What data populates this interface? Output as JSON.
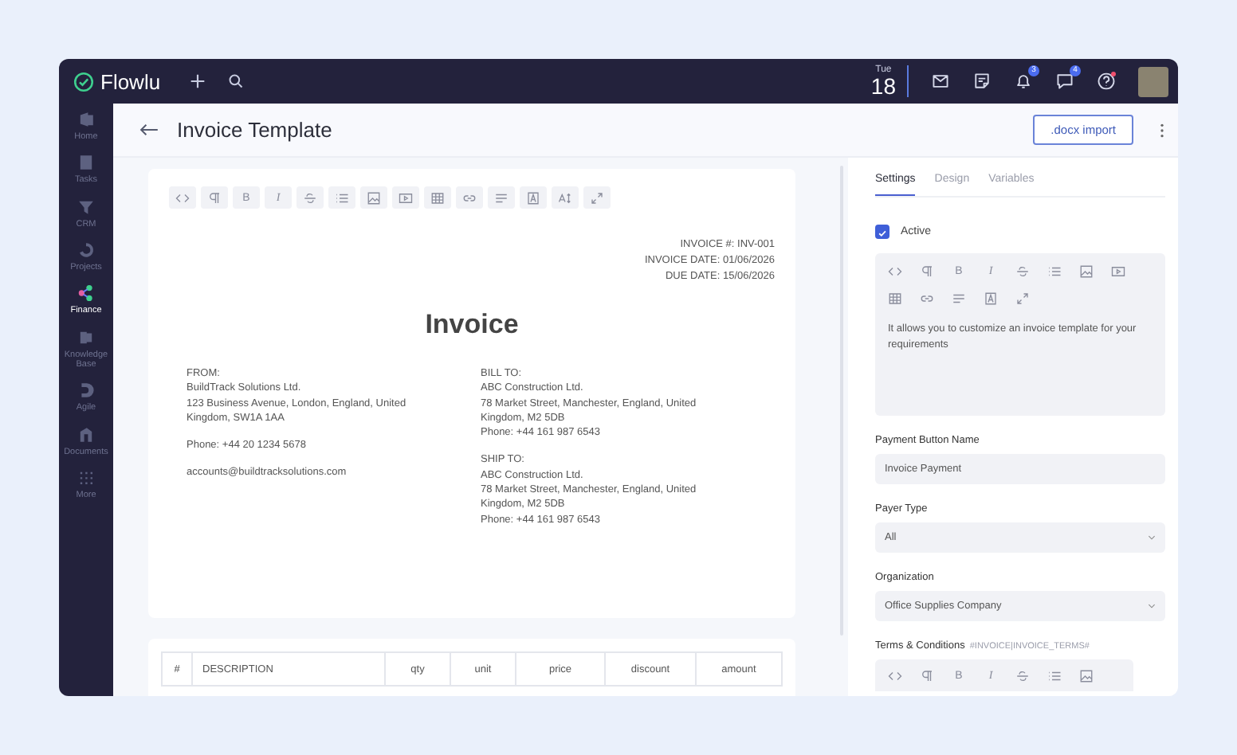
{
  "topbar": {
    "brand": "Flowlu",
    "date": {
      "weekday": "Tue",
      "day": "18"
    },
    "notifications": [
      {
        "kind": "mail"
      },
      {
        "kind": "notes"
      },
      {
        "kind": "bell",
        "count": "3"
      },
      {
        "kind": "chat",
        "count": "4"
      },
      {
        "kind": "help",
        "alert": true
      }
    ]
  },
  "sidebar": {
    "items": [
      {
        "label": "Home",
        "selected": false
      },
      {
        "label": "Tasks",
        "selected": false
      },
      {
        "label": "CRM",
        "selected": false
      },
      {
        "label": "Projects",
        "selected": false
      },
      {
        "label": "Finance",
        "selected": true
      },
      {
        "label": "Knowledge Base",
        "selected": false
      },
      {
        "label": "Agile",
        "selected": false
      },
      {
        "label": "Documents",
        "selected": false
      },
      {
        "label": "More",
        "selected": false
      }
    ]
  },
  "header": {
    "title": "Invoice Template",
    "import_button": ".docx import"
  },
  "editor_toolbar": [
    {
      "kind": "code"
    },
    {
      "kind": "paragraph"
    },
    {
      "kind": "glyph",
      "label": "B"
    },
    {
      "kind": "glyph",
      "label": "I"
    },
    {
      "kind": "strike"
    },
    {
      "kind": "list"
    },
    {
      "kind": "image"
    },
    {
      "kind": "video"
    },
    {
      "kind": "table"
    },
    {
      "kind": "link"
    },
    {
      "kind": "align"
    },
    {
      "kind": "color"
    },
    {
      "kind": "fontsize"
    },
    {
      "kind": "fullscreen"
    }
  ],
  "document": {
    "meta": [
      "INVOICE #: INV-001",
      "INVOICE DATE: 01/06/2026",
      "DUE DATE: 15/06/2026"
    ],
    "title": "Invoice",
    "from": {
      "lines": [
        "FROM:",
        "BuildTrack Solutions Ltd.",
        "123 Business Avenue, London, England, United Kingdom, SW1A 1AA"
      ],
      "phone": "Phone: +44 20 1234 5678",
      "email": "accounts@buildtracksolutions.com"
    },
    "bill_to": [
      "BILL TO:",
      "ABC Construction Ltd.",
      "78 Market Street, Manchester, England, United Kingdom, M2 5DB",
      "Phone: +44 161 987 6543"
    ],
    "ship_to": [
      "SHIP TO:",
      "ABC Construction Ltd.",
      "78 Market Street, Manchester, England, United Kingdom, M2 5DB",
      "Phone: +44 161 987 6543"
    ]
  },
  "table": {
    "columns": [
      "#",
      "DESCRIPTION",
      "qty",
      "unit",
      "price",
      "discount",
      "amount"
    ]
  },
  "settings": {
    "tabs": [
      {
        "label": "Settings",
        "selected": true
      },
      {
        "label": "Design",
        "selected": false
      },
      {
        "label": "Variables",
        "selected": false
      }
    ],
    "active": {
      "label": "Active",
      "checked": true
    },
    "description_toolbar": [
      {
        "kind": "code"
      },
      {
        "kind": "paragraph"
      },
      {
        "kind": "glyph",
        "label": "B"
      },
      {
        "kind": "glyph",
        "label": "I"
      },
      {
        "kind": "strike"
      },
      {
        "kind": "list"
      },
      {
        "kind": "image"
      },
      {
        "kind": "video"
      },
      {
        "kind": "table"
      },
      {
        "kind": "link"
      },
      {
        "kind": "align"
      },
      {
        "kind": "color"
      },
      {
        "kind": "fullscreen"
      }
    ],
    "description": "It allows you to customize an invoice template for your requirements",
    "fields": [
      {
        "kind": "input",
        "label": "Payment Button Name",
        "value": "Invoice Payment"
      },
      {
        "kind": "select",
        "label": "Payer Type",
        "value": "All"
      },
      {
        "kind": "select",
        "label": "Organization",
        "value": "Office Supplies Company"
      }
    ],
    "terms": {
      "label": "Terms & Conditions",
      "variable": "#INVOICE|INVOICE_TERMS#"
    },
    "terms_toolbar": [
      {
        "kind": "code"
      },
      {
        "kind": "paragraph"
      },
      {
        "kind": "glyph",
        "label": "B"
      },
      {
        "kind": "glyph",
        "label": "I"
      },
      {
        "kind": "strike"
      },
      {
        "kind": "list"
      },
      {
        "kind": "image"
      }
    ]
  }
}
